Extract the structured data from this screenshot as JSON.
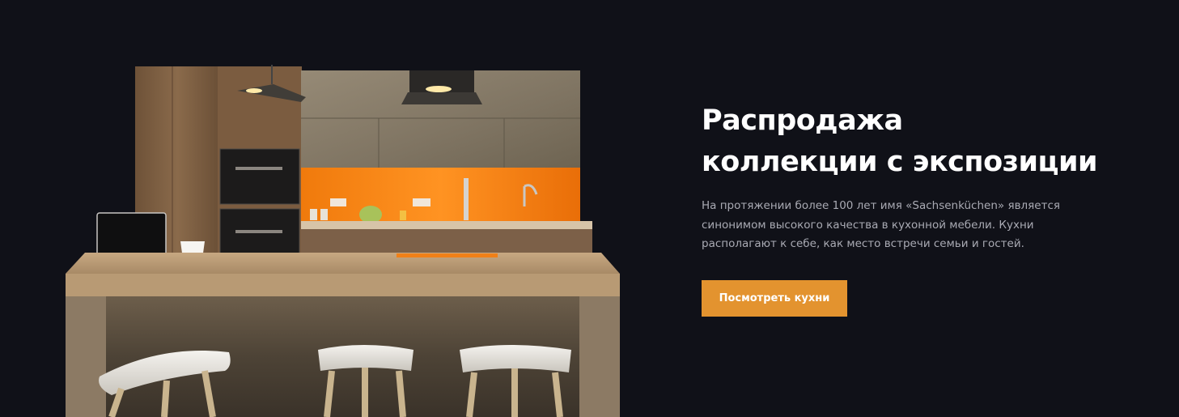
{
  "hero": {
    "title_line1": "Распродажа",
    "title_line2": "коллекции с экспозиции",
    "description": "На протяжении более 100 лет имя «Sachsenküchen» является синонимом высокого качества в кухонной мебели. Кухни располагают к себе, как место встречи семьи и гостей.",
    "cta_label": "Посмотреть кухни",
    "image": "kitchen-showroom-photo"
  },
  "colors": {
    "background": "#101118",
    "accent": "#e3932f",
    "text": "#ffffff",
    "muted_text": "#a9aab3",
    "backsplash": "#f07d12"
  }
}
